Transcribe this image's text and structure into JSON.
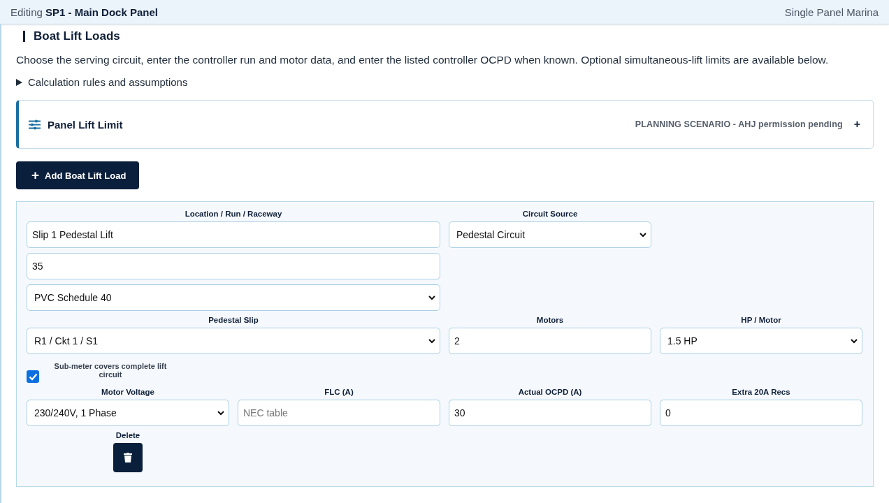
{
  "header": {
    "prefix": "Editing",
    "title": "SP1 - Main Dock Panel",
    "project": "Single Panel Marina"
  },
  "section": {
    "title": "Boat Lift Loads",
    "description": "Choose the serving circuit, enter the controller run and motor data, and enter the listed controller OCPD when known. Optional simultaneous-lift limits are available below.",
    "disclosure": {
      "label": "Calculation rules and assumptions",
      "expanded": false
    }
  },
  "limit_panel": {
    "title": "Panel Lift Limit",
    "status": "PLANNING SCENARIO - AHJ permission pending",
    "toggle": "+",
    "expanded": false
  },
  "add_button": {
    "icon": "+",
    "label": "Add Boat Lift Load"
  },
  "load_fields": [
    {
      "kind": "input",
      "label": "Location / Run / Raceway",
      "value": "Slip 1 Pedestal Lift"
    },
    {
      "kind": "select",
      "label": "Circuit Source",
      "value": "Pedestal Circuit"
    },
    {
      "kind": "input",
      "value": "35"
    },
    {
      "kind": "select",
      "value": "PVC Schedule 40"
    },
    {
      "kind": "select",
      "label": "Pedestal Slip",
      "value": "R1 / Ckt 1 / S1"
    },
    {
      "kind": "input",
      "label": "Motors",
      "value": "2"
    },
    {
      "kind": "select",
      "label": "HP / Motor",
      "value": "1.5 HP"
    },
    {
      "kind": "checkbox",
      "label": "Sub-meter covers complete lift circuit",
      "checked": true
    },
    {
      "kind": "select",
      "label": "Motor Voltage",
      "value": "230/240V, 1 Phase"
    },
    {
      "kind": "input",
      "label": "FLC (A)",
      "placeholder": "NEC table"
    },
    {
      "kind": "input",
      "label": "Actual OCPD (A)",
      "value": "30"
    },
    {
      "kind": "input",
      "label": "Extra 20A Recs",
      "value": "0"
    },
    {
      "kind": "button",
      "label": "Delete"
    }
  ]
}
